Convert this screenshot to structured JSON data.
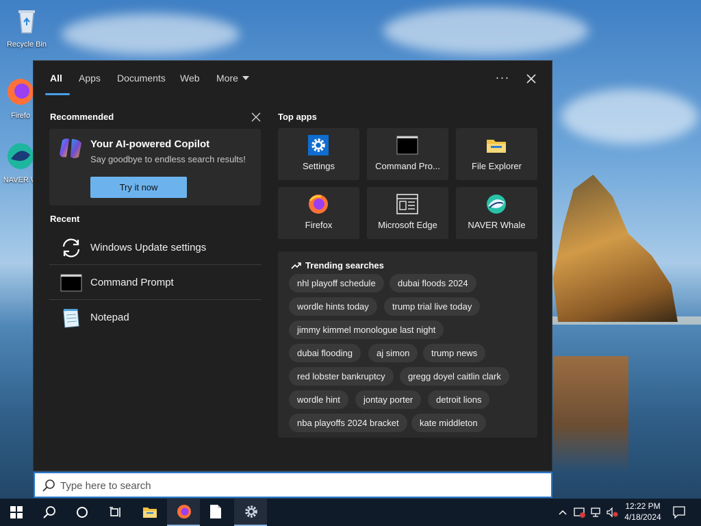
{
  "desktop": {
    "icons": [
      {
        "label": "Recycle Bin"
      },
      {
        "label": "Firefo"
      },
      {
        "label": "NAVER W"
      }
    ]
  },
  "panel": {
    "tabs": [
      {
        "label": "All"
      },
      {
        "label": "Apps"
      },
      {
        "label": "Documents"
      },
      {
        "label": "Web"
      },
      {
        "label": "More"
      }
    ],
    "more_options_label": "···",
    "close_label": "✕",
    "recommended": {
      "title": "Recommended",
      "copilot_title": "Your AI-powered Copilot",
      "copilot_subtitle": "Say goodbye to endless search results!",
      "try_button": "Try it now"
    },
    "recent": {
      "title": "Recent",
      "items": [
        {
          "label": "Windows Update settings",
          "icon": "refresh-icon"
        },
        {
          "label": "Command Prompt",
          "icon": "command-prompt-icon"
        },
        {
          "label": "Notepad",
          "icon": "notepad-icon"
        }
      ]
    },
    "top_apps": {
      "title": "Top apps",
      "apps": [
        {
          "label": "Settings",
          "icon": "gear-icon"
        },
        {
          "label": "Command Pro...",
          "icon": "command-prompt-icon"
        },
        {
          "label": "File Explorer",
          "icon": "folder-icon"
        },
        {
          "label": "Firefox",
          "icon": "firefox-icon"
        },
        {
          "label": "Microsoft Edge",
          "icon": "edge-icon"
        },
        {
          "label": "NAVER Whale",
          "icon": "whale-icon"
        }
      ]
    },
    "trending": {
      "title": "Trending searches",
      "chips": [
        "nhl playoff schedule",
        "dubai floods 2024",
        "wordle hints today",
        "trump trial live today",
        "jimmy kimmel monologue last night",
        "dubai flooding",
        "aj simon",
        "trump news",
        "red lobster bankruptcy",
        "gregg doyel caitlin clark",
        "wordle hint",
        "jontay porter",
        "detroit lions",
        "nba playoffs 2024 bracket",
        "kate middleton"
      ]
    }
  },
  "search": {
    "placeholder": "Type here to search",
    "value": ""
  },
  "taskbar": {
    "time": "12:22 PM",
    "date": "4/18/2024"
  },
  "colors": {
    "accent": "#4aa0ec",
    "panel_bg": "#202020",
    "card_bg": "#2b2b2b",
    "button_blue": "#6cb3ee",
    "taskbar_bg": "#101b2a"
  }
}
